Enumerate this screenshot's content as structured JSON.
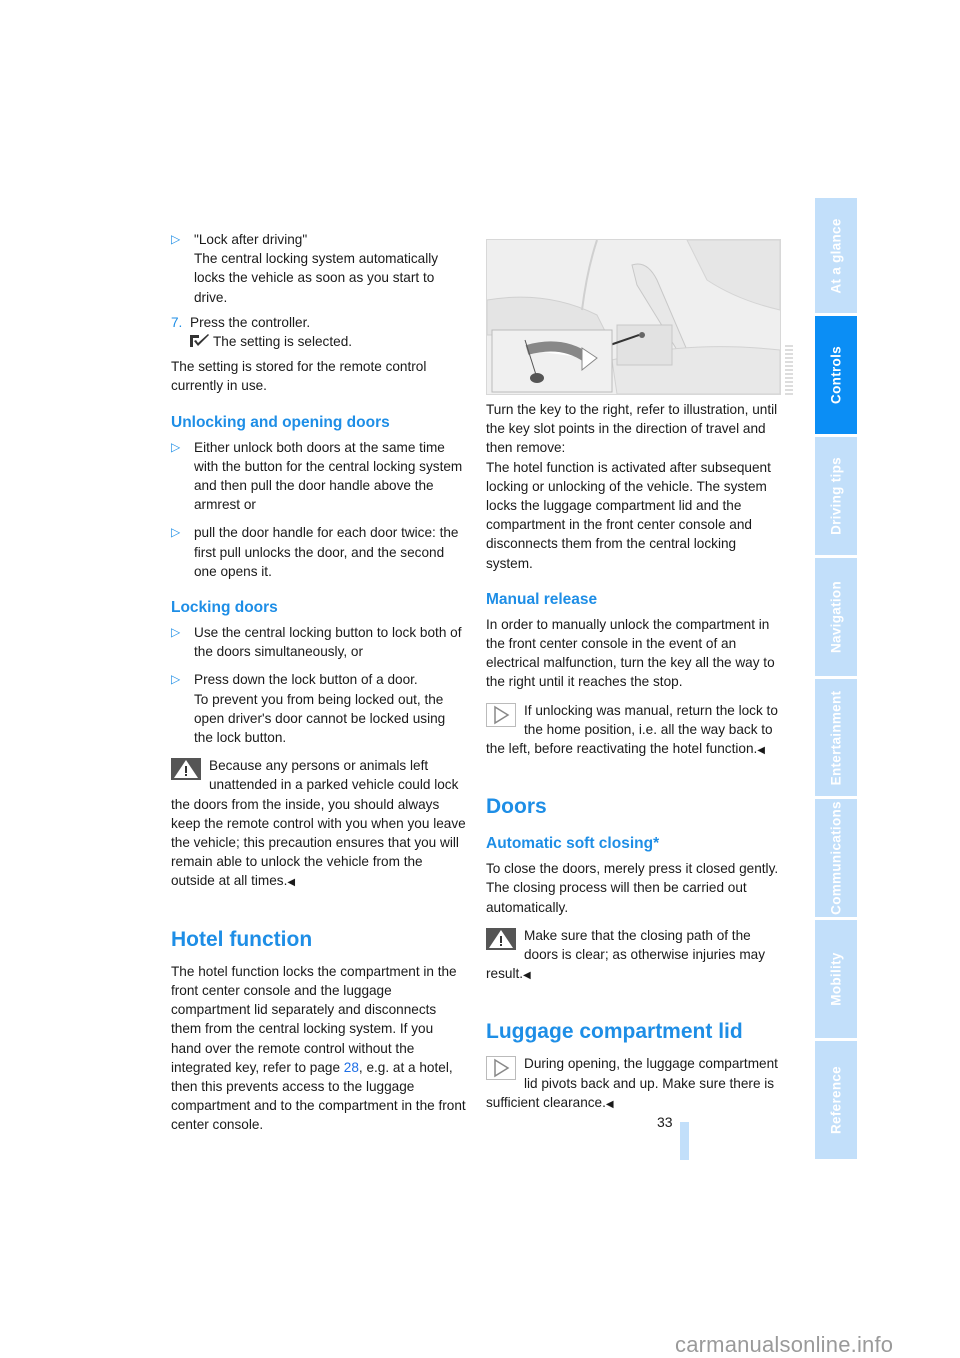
{
  "left_column": {
    "lock_after_driving_title": "\"Lock after driving\"",
    "lock_after_driving_text": "The central locking system automatically locks the vehicle as soon as you start to drive.",
    "step7_number": "7.",
    "step7_text": "Press the controller.",
    "step7_result": "The setting is selected.",
    "stored_text": "The setting is stored for the remote control currently in use.",
    "unlocking_heading": "Unlocking and opening doors",
    "unlocking_bullets": [
      "Either unlock both doors at the same time with the button for the central locking system and then pull the door handle above the armrest or",
      "pull the door handle for each door twice: the first pull unlocks the door, and the second one opens it."
    ],
    "locking_heading": "Locking doors",
    "locking_bullet1": "Use the central locking button to lock both of the doors simultaneously, or",
    "locking_bullet2_line1": "Press down the lock button of a door.",
    "locking_bullet2_line2": "To prevent you from being locked out, the open driver's door cannot be locked using the lock button.",
    "warning_text": "Because any persons or animals left unattended in a parked vehicle could lock the doors from the inside, you should always keep the remote control with you when you leave the vehicle; this precaution ensures that you will remain able to unlock the vehicle from the outside at all times.",
    "hotel_heading": "Hotel function",
    "hotel_text_before_link": "The hotel function locks the compartment in the front center console and the luggage compartment lid separately and disconnects them from the central locking system. If you hand over the remote control without the integrated key, refer to page ",
    "hotel_link": "28",
    "hotel_text_after_link": ", e.g. at a hotel, then this prevents access to the luggage compartment and to the compartment in the front center console."
  },
  "right_column": {
    "turn_key_text": "Turn the key to the right, refer to illustration, until the key slot points in the direction of travel and then remove:",
    "hotel_activated_text": "The hotel function is activated after subsequent locking or unlocking of the vehicle. The system locks the luggage compartment lid and the compartment in the front center console and disconnects them from the central locking system.",
    "manual_heading": "Manual release",
    "manual_text": "In order to manually unlock the compartment in the front center console in the event of an electrical malfunction, turn the key all the way to the right until it reaches the stop.",
    "manual_note": "If unlocking was manual, return the lock to the home position, i.e. all the way back to the left, before reactivating the hotel function.",
    "doors_heading": "Doors",
    "soft_close_heading": "Automatic soft closing*",
    "soft_close_text": "To close the doors, merely press it closed gently. The closing process will then be carried out automatically.",
    "soft_close_warning": "Make sure that the closing path of the doors is clear; as otherwise injuries may result.",
    "luggage_heading": "Luggage compartment lid",
    "luggage_note": "During opening, the luggage compartment lid pivots back and up. Make sure there is sufficient clearance."
  },
  "end_mark": "◀",
  "bullet_glyph": "▷",
  "sidebar": {
    "tabs": [
      {
        "label": "At a glance",
        "active": false
      },
      {
        "label": "Controls",
        "active": true
      },
      {
        "label": "Driving tips",
        "active": false
      },
      {
        "label": "Navigation",
        "active": false
      },
      {
        "label": "Entertainment",
        "active": false
      },
      {
        "label": "Communications",
        "active": false
      },
      {
        "label": "Mobility",
        "active": false
      },
      {
        "label": "Reference",
        "active": false
      }
    ]
  },
  "page_number": "33",
  "watermark": "carmanualsonline.info",
  "colors": {
    "accent": "#1e8ee6",
    "tab_active": "#0b8ef5",
    "tab_inactive": "#c2dffa"
  }
}
